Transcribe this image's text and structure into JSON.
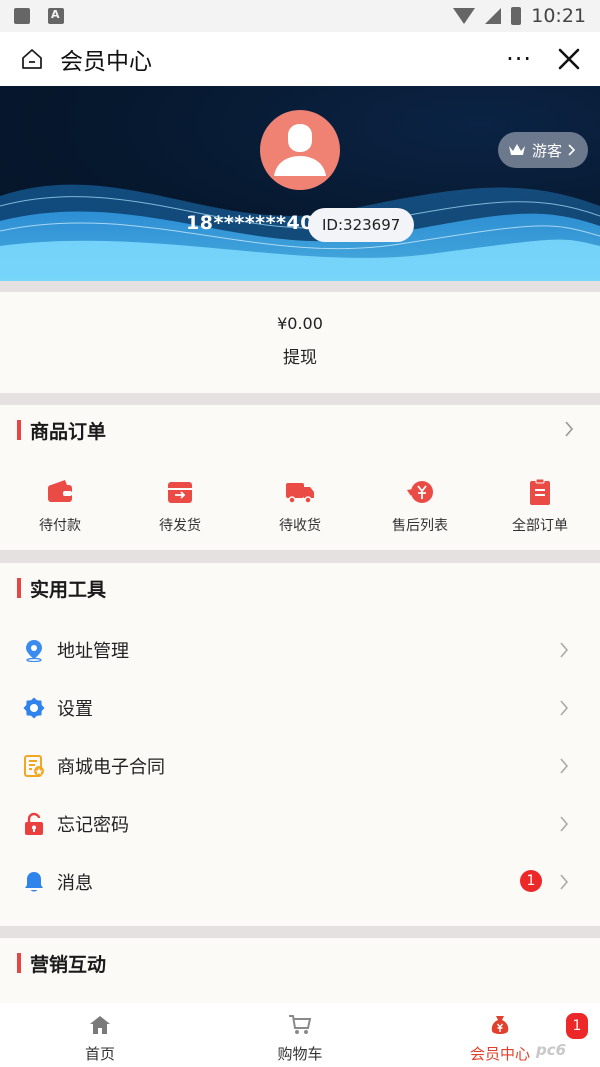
{
  "status_bar": {
    "time": "10:21"
  },
  "title_bar": {
    "title": "会员中心",
    "more": "···"
  },
  "profile": {
    "phone": "18*******40",
    "user_id": "ID:323697",
    "visitor_label": "游客"
  },
  "balance": {
    "amount": "¥0.00",
    "withdraw_label": "提现"
  },
  "orders": {
    "title": "商品订单",
    "items": [
      {
        "label": "待付款",
        "icon": "wallet-icon"
      },
      {
        "label": "待发货",
        "icon": "box-icon"
      },
      {
        "label": "待收货",
        "icon": "truck-icon"
      },
      {
        "label": "售后列表",
        "icon": "refund-icon"
      },
      {
        "label": "全部订单",
        "icon": "clipboard-icon"
      }
    ]
  },
  "tools": {
    "title": "实用工具",
    "items": [
      {
        "label": "地址管理",
        "icon": "location-pin-icon"
      },
      {
        "label": "设置",
        "icon": "gear-icon"
      },
      {
        "label": "商城电子合同",
        "icon": "contract-icon"
      },
      {
        "label": "忘记密码",
        "icon": "lock-icon"
      },
      {
        "label": "消息",
        "icon": "bell-icon",
        "badge": "1"
      }
    ]
  },
  "marketing": {
    "title": "营销互动"
  },
  "tab_bar": {
    "items": [
      {
        "label": "首页",
        "icon": "home-icon"
      },
      {
        "label": "购物车",
        "icon": "cart-icon"
      },
      {
        "label": "会员中心",
        "icon": "money-bag-icon",
        "active": true
      }
    ],
    "cart_badge": "1"
  },
  "watermark": "pc6",
  "colors": {
    "accent": "#e84545",
    "active_tab": "#e0402c",
    "badge": "#ec2828",
    "hero_bg": "#06182e"
  }
}
